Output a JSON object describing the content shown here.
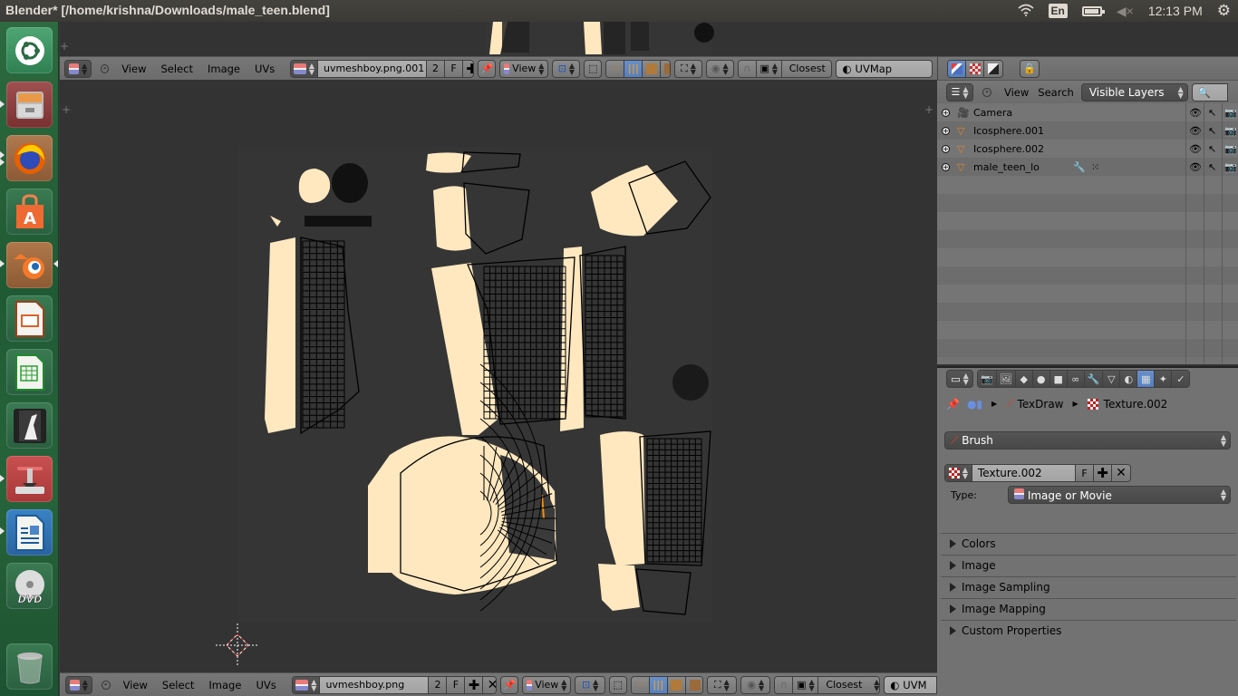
{
  "topbar": {
    "window_title": "Blender* [/home/krishna/Downloads/male_teen.blend]",
    "keyboard_layout": "En",
    "clock": "12:13 PM",
    "icons": [
      "wifi-icon",
      "keyboard-layout-icon",
      "battery-icon",
      "volume-muted-icon",
      "power-gear-icon"
    ]
  },
  "launcher": {
    "items": [
      {
        "name": "ubuntu-dash",
        "glyph": "◎",
        "color": "#3e8a5a"
      },
      {
        "name": "files",
        "glyph": "▭",
        "color": "#8a3a3a"
      },
      {
        "name": "firefox",
        "glyph": "●",
        "color": "#9a5a36"
      },
      {
        "name": "software-center",
        "glyph": "A",
        "color": "#2f6b47"
      },
      {
        "name": "blender",
        "glyph": "◉",
        "color": "#a86a36"
      },
      {
        "name": "libreoffice-impress",
        "glyph": "▤",
        "color": "#2f6b47"
      },
      {
        "name": "libreoffice-calc",
        "glyph": "▦",
        "color": "#2f6b47"
      },
      {
        "name": "video-editor",
        "glyph": "▮",
        "color": "#2f6b47"
      },
      {
        "name": "update-installer",
        "glyph": "⇩",
        "color": "#b94040"
      },
      {
        "name": "libreoffice-writer",
        "glyph": "≣",
        "color": "#2a6aa8"
      },
      {
        "name": "dvd",
        "glyph": "DVD",
        "color": "#2f6b47"
      },
      {
        "name": "trash",
        "glyph": "🗑",
        "color": "#2f6b47"
      }
    ]
  },
  "uv_header_top": {
    "menus": [
      "View",
      "Select",
      "Image",
      "UVs"
    ],
    "image_name": "uvmeshboy.png.001",
    "users": "2",
    "fake_user": "F",
    "view_dropdown": "View",
    "snap_mode": "Closest",
    "uv_map": "UVMap"
  },
  "uv_header_bottom": {
    "menus": [
      "View",
      "Select",
      "Image",
      "UVs"
    ],
    "image_name": "uvmeshboy.png",
    "users": "2",
    "fake_user": "F",
    "view_dropdown": "View",
    "snap_mode": "Closest",
    "uv_map": "UVM"
  },
  "outliner": {
    "menus": [
      "View",
      "Search"
    ],
    "display_mode": "Visible Layers",
    "objects": [
      {
        "name": "Camera",
        "type_icon": "camera-icon"
      },
      {
        "name": "Icosphere.001",
        "type_icon": "mesh-icon"
      },
      {
        "name": "Icosphere.002",
        "type_icon": "mesh-icon"
      },
      {
        "name": "male_teen_lo",
        "type_icon": "mesh-icon",
        "has_modifier": true,
        "active": true
      }
    ]
  },
  "properties": {
    "breadcrumb": {
      "brush": "TexDraw",
      "texture": "Texture.002"
    },
    "context_dropdown": "Brush",
    "texture_name": "Texture.002",
    "fake_user": "F",
    "type_label": "Type:",
    "type_value": "Image or Movie",
    "panels": [
      "Colors",
      "Image",
      "Image Sampling",
      "Image Mapping",
      "Custom Properties"
    ],
    "tabs": [
      "render",
      "render-layers",
      "scene",
      "world",
      "object",
      "constraints",
      "modifiers",
      "data",
      "material",
      "texture",
      "particles",
      "physics"
    ],
    "active_tab": "texture"
  },
  "colors": {
    "uv_island": "#ffe8bf",
    "selected_edge": "#ff8c00",
    "accent_blue": "#5680c2"
  }
}
